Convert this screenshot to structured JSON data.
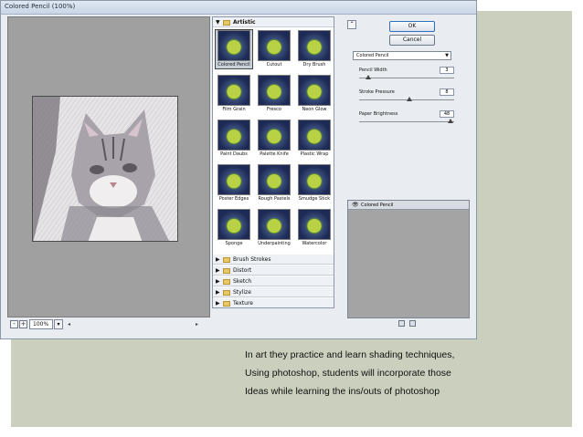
{
  "window": {
    "title": "Colored Pencil (100%)"
  },
  "preview": {
    "zoom": "100%",
    "zoom_out_symbol": "-",
    "zoom_in_symbol": "+",
    "zoom_dropdown_symbol": "▾"
  },
  "gallery": {
    "open_category": "Artistic",
    "artistic_filters": [
      "Colored Pencil",
      "Cutout",
      "Dry Brush",
      "Film Grain",
      "Fresco",
      "Neon Glow",
      "Paint Daubs",
      "Palette Knife",
      "Plastic Wrap",
      "Poster Edges",
      "Rough Pastels",
      "Smudge Stick",
      "Sponge",
      "Underpainting",
      "Watercolor"
    ],
    "selected_filter": "Colored Pencil",
    "other_categories": [
      "Brush Strokes",
      "Distort",
      "Sketch",
      "Stylize",
      "Texture"
    ]
  },
  "settings": {
    "ok_label": "OK",
    "cancel_label": "Cancel",
    "filter": "Colored Pencil",
    "params": [
      {
        "label": "Pencil Width",
        "value": "3",
        "fraction": 0.1
      },
      {
        "label": "Stroke Pressure",
        "value": "8",
        "fraction": 0.53
      },
      {
        "label": "Paper Brightness",
        "value": "48",
        "fraction": 0.96
      }
    ]
  },
  "layers": {
    "items": [
      "Colored Pencil"
    ]
  },
  "caption": {
    "lines": [
      "In art they practice and learn shading techniques,",
      "Using photoshop, students will incorporate those",
      "Ideas while learning the ins/outs of photoshop"
    ]
  },
  "colors": {
    "slide_background": "#cbcfbd",
    "preview_background": "#a0a0a0",
    "ok_border": "#2f6fbf"
  }
}
